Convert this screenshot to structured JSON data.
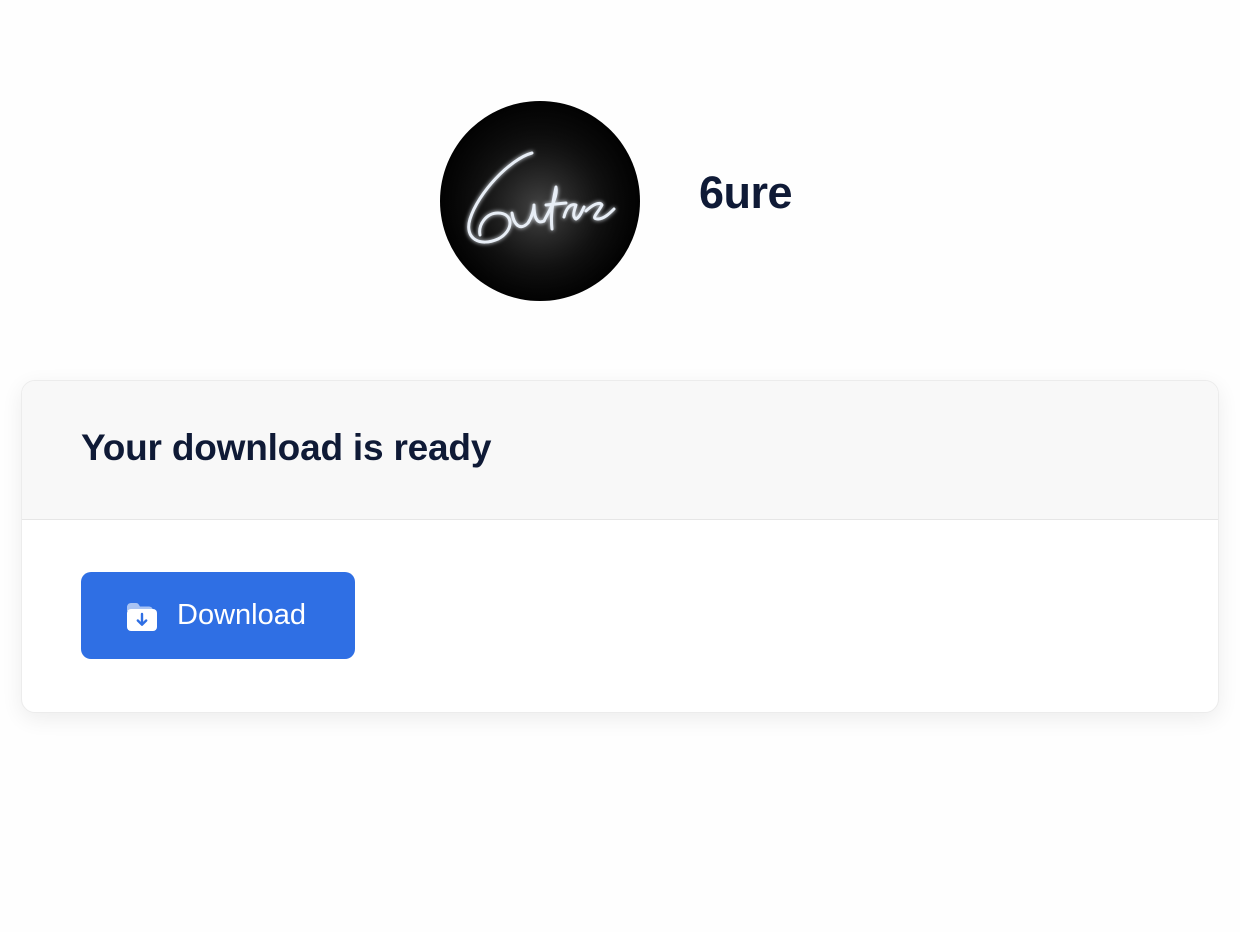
{
  "profile": {
    "name": "6ure",
    "avatar_logo_text": "6ure"
  },
  "card": {
    "title": "Your download is ready",
    "download_button_label": "Download"
  },
  "icons": {
    "download": "folder-download-icon"
  },
  "colors": {
    "text": "#0f1a36",
    "button": "#2f6fe4",
    "button_text": "#ffffff",
    "header_bg": "#f8f8f8",
    "avatar_bg": "#000000"
  }
}
